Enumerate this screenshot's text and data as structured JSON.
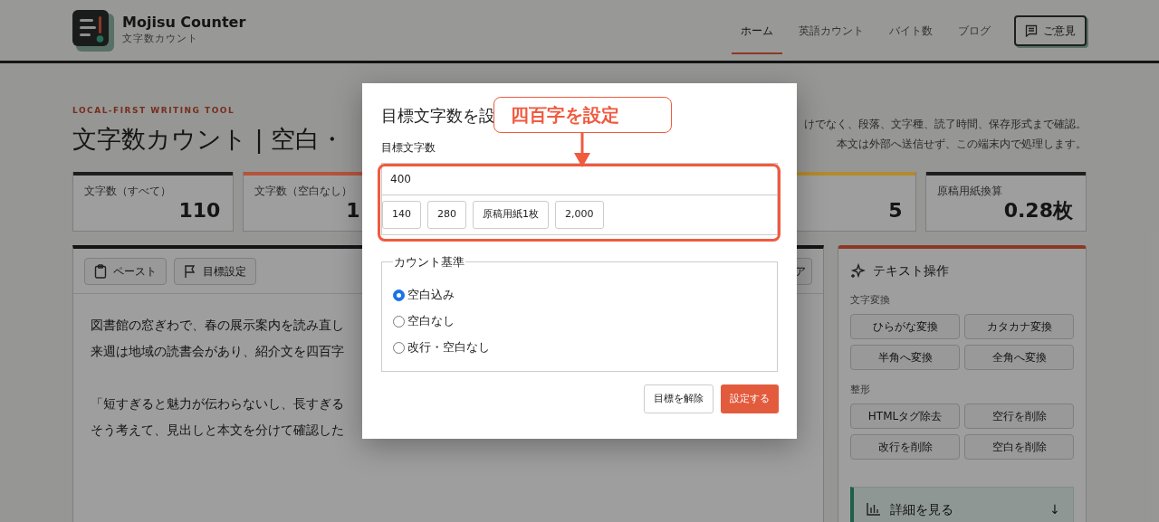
{
  "header": {
    "title": "Mojisu Counter",
    "subtitle": "文字数カウント",
    "nav": [
      {
        "label": "ホーム",
        "selected": true
      },
      {
        "label": "英語カウント",
        "selected": false
      },
      {
        "label": "バイト数",
        "selected": false
      },
      {
        "label": "ブログ",
        "selected": false
      }
    ],
    "feedback_button": "ご意見"
  },
  "hero": {
    "eyebrow": "LOCAL-FIRST WRITING TOOL",
    "title": "文字数カウント | 空白・",
    "description": [
      "けでなく、段落、文字種、読了時間、保存形式まで確認。",
      "本文は外部へ送信せず、この端末内で処理します。"
    ]
  },
  "stats": [
    {
      "label": "文字数（すべて）",
      "value": "110",
      "color": "#1e1e1e"
    },
    {
      "label": "文字数（空白なし）",
      "value": "1",
      "color": "#b5533c"
    },
    {
      "value": "5",
      "color": "#b38a2c"
    },
    {
      "label": "原稿用紙換算",
      "value": "0.28枚",
      "color": "#1e1e1e"
    }
  ],
  "editor": {
    "toolbar": [
      {
        "label": "ペースト",
        "kind": "paste"
      },
      {
        "label": "目標設定",
        "kind": "target"
      },
      {
        "label": "ア",
        "kind": "plain"
      }
    ],
    "paragraphs": [
      [
        "図書館の窓ぎわで、春の展示案内を読み直し",
        "来週は地域の読書会があり、紹介文を四百字"
      ],
      [
        "「短すぎると魅力が伝わらないし、長すぎる",
        "そう考えて、見出しと本文を分けて確認した"
      ]
    ]
  },
  "sidebar": {
    "title": "テキスト操作",
    "groups": [
      {
        "heading": "文字変換",
        "buttons": [
          "ひらがな変換",
          "カタカナ変換",
          "半角へ変換",
          "全角へ変換"
        ]
      },
      {
        "heading": "整形",
        "buttons": [
          "HTMLタグ除去",
          "空行を削除",
          "改行を削除",
          "空白を削除"
        ]
      }
    ],
    "details_button": "詳細を見る",
    "details_arrow": "↓"
  },
  "dialog": {
    "title": "目標文字数を設",
    "field_label": "目標文字数",
    "value": "400",
    "presets": [
      "140",
      "280",
      "原稿用紙1枚",
      "2,000"
    ],
    "basis": {
      "legend": "カウント基準",
      "options": [
        {
          "label": "空白込み",
          "selected": true
        },
        {
          "label": "空白なし",
          "selected": false
        },
        {
          "label": "改行・空白なし",
          "selected": false
        }
      ]
    },
    "buttons": [
      {
        "label": "目標を解除",
        "kind": "secondary"
      },
      {
        "label": "設定する",
        "kind": "primary"
      }
    ]
  },
  "annotation": {
    "text": "四百字を設定"
  }
}
